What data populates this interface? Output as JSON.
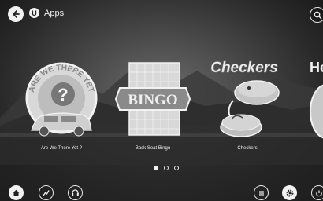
{
  "header": {
    "title": "Apps",
    "user_badge": "U"
  },
  "apps": [
    {
      "label": "Are We There Yet ?",
      "logo_text": "ARE WE THERE YET",
      "symbol": "?"
    },
    {
      "label": "Back Seat Bingo",
      "logo_text": "BINGO"
    },
    {
      "label": "Checkers",
      "logo_text": "Checkers"
    },
    {
      "logo_text": "He"
    }
  ],
  "pagination": {
    "current": 1,
    "total": 3
  },
  "icons": {
    "back": "back-arrow-icon",
    "search": "search-icon",
    "home": "home-icon",
    "trend": "trend-icon",
    "headset": "headset-icon",
    "menu": "menu-icon",
    "settings": "gear-icon",
    "power": "power-icon"
  }
}
